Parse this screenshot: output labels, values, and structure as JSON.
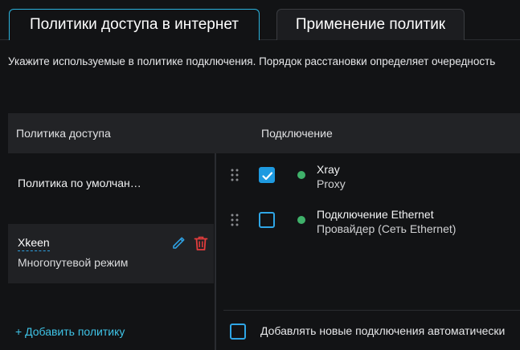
{
  "tabs": [
    {
      "label": "Политики доступа в интернет",
      "active": true
    },
    {
      "label": "Применение политик",
      "active": false
    }
  ],
  "description": "Укажите используемые в политике подключения. Порядок расстановки определяет очередность",
  "table": {
    "policy_header": "Политика доступа",
    "connection_header": "Подключение"
  },
  "policies": [
    {
      "name": "Политика по умолчан…"
    },
    {
      "name": "Xkeen",
      "subtitle": "Многопутевой режим",
      "selected": true
    }
  ],
  "add_policy_label": "+ Добавить политику",
  "connections": [
    {
      "name": "Xray",
      "subtitle": "Proxy",
      "checked": true,
      "status_color": "#3fb16a"
    },
    {
      "name": "Подключение Ethernet",
      "subtitle": "Провайдер (Сеть Ethernet)",
      "checked": false,
      "status_color": "#3fb16a"
    }
  ],
  "auto_add_label": "Добавлять новые подключения автоматически",
  "auto_add_checked": false,
  "colors": {
    "accent": "#2bb3dd",
    "delete": "#e23c3c",
    "link": "#3fc3e6"
  },
  "icons": {
    "edit": "pencil-icon",
    "delete": "trash-icon",
    "drag": "drag-handle-icon",
    "check": "check-icon"
  }
}
